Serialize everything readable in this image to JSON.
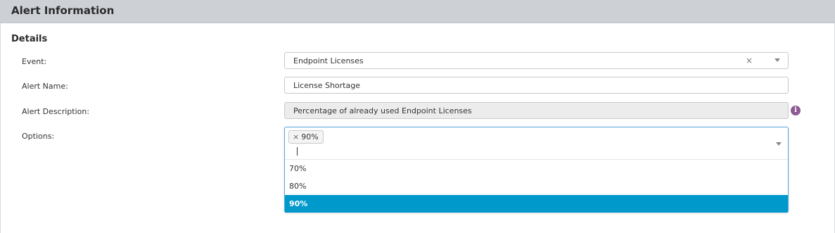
{
  "panel": {
    "title": "Alert Information"
  },
  "section": {
    "title": "Details"
  },
  "fields": {
    "event": {
      "label": "Event:",
      "value": "Endpoint Licenses",
      "clear": "×"
    },
    "alert_name": {
      "label": "Alert Name:",
      "value": "License Shortage"
    },
    "alert_description": {
      "label": "Alert Description:",
      "value": "Percentage of already used Endpoint Licenses",
      "info_icon": "i"
    },
    "options": {
      "label": "Options:",
      "selected_tags": [
        {
          "remove": "×",
          "label": "90%"
        }
      ],
      "dropdown_options": [
        {
          "label": "70%",
          "selected": false
        },
        {
          "label": "80%",
          "selected": false
        },
        {
          "label": "90%",
          "selected": true
        }
      ]
    }
  },
  "colors": {
    "header_bg": "#cdd1d6",
    "highlight": "#0099cc",
    "info_icon": "#8e5a92",
    "focus_border": "#5aa8d8"
  },
  "icons": [
    "clear-icon",
    "chevron-down-icon",
    "info-icon",
    "tag-remove-icon"
  ]
}
